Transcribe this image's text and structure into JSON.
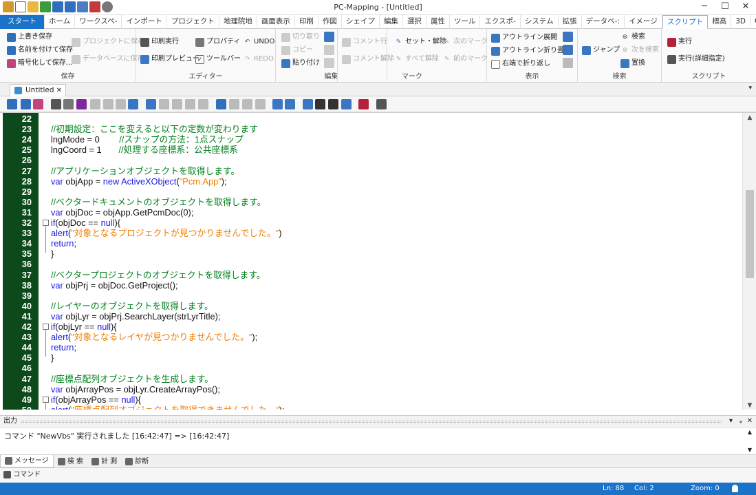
{
  "window": {
    "title": "PC-Mapping - [Untitled]",
    "minimize": "─",
    "maximize": "☐",
    "close": "✕"
  },
  "ribbon_tabs": [
    "スタート",
    "ホーム",
    "ワークスペ-",
    "インポート",
    "プロジェクト",
    "地理院地",
    "画面表示",
    "印刷",
    "作図",
    "シェイプ",
    "編集",
    "選択",
    "属性",
    "ツール",
    "エクスポ-",
    "システム",
    "拡張",
    "データベ-:",
    "イメージ",
    "スクリプト",
    "標高",
    "3D",
    "GL"
  ],
  "ribbon": {
    "save": {
      "label": "保存",
      "overwrite": "上書き保存",
      "save_as": "名前を付けて保存",
      "encrypt": "暗号化して保存...",
      "to_project": "プロジェクトに保存",
      "to_db": "データベースに保存"
    },
    "editor": {
      "label": "エディター",
      "print": "印刷実行",
      "preview": "印刷プレビュー",
      "property": "プロパティ",
      "toolbar": "ツールバー"
    },
    "edit": {
      "label": "編集",
      "undo": "UNDO",
      "redo": "REDO",
      "cut": "切り取り",
      "copy": "コピー",
      "paste": "貼り付け"
    },
    "mark": {
      "label": "マーク",
      "comment": "コメント行",
      "uncomment": "コメント解除",
      "set_clear": "セット・解除",
      "clear_all": "すべて解除",
      "next": "次のマーク",
      "prev": "前のマーク"
    },
    "view": {
      "label": "表示",
      "outline_expand": "アウトライン展開",
      "outline_fold": "アウトライン折り畳み",
      "wrap_right": "右端で折り返し"
    },
    "search": {
      "label": "検索",
      "jump": "ジャンプ",
      "find": "検索",
      "find_next": "次を検索",
      "replace": "置換"
    },
    "script": {
      "label": "スクリプト",
      "run": "実行",
      "run_detail": "実行(詳細指定)"
    }
  },
  "doc_tab": {
    "name": "Untitled",
    "close": "✕"
  },
  "code_lines": [
    {
      "n": "22",
      "segs": []
    },
    {
      "n": "23",
      "segs": [
        [
          "cmt",
          "//初期設定：ここを変えると以下の定数が変わります"
        ]
      ]
    },
    {
      "n": "24",
      "segs": [
        [
          "pl",
          "lngMode = 0        "
        ],
        [
          "cmt",
          "//スナップの方法：1点スナップ"
        ]
      ]
    },
    {
      "n": "25",
      "segs": [
        [
          "pl",
          "lngCoord = 1       "
        ],
        [
          "cmt",
          "//処理する座標系：公共座標系"
        ]
      ]
    },
    {
      "n": "26",
      "segs": []
    },
    {
      "n": "27",
      "segs": [
        [
          "cmt",
          "//アプリケーションオブジェクトを取得します。"
        ]
      ]
    },
    {
      "n": "28",
      "segs": [
        [
          "kw",
          "var "
        ],
        [
          "pl",
          "objApp = "
        ],
        [
          "kw",
          "new ActiveXObject"
        ],
        [
          "pl",
          "("
        ],
        [
          "str",
          "\"Pcm.App\""
        ],
        [
          "pl",
          ");"
        ]
      ]
    },
    {
      "n": "29",
      "segs": []
    },
    {
      "n": "30",
      "segs": [
        [
          "cmt",
          "//ベクタードキュメントのオブジェクトを取得します。"
        ]
      ]
    },
    {
      "n": "31",
      "segs": [
        [
          "kw",
          "var "
        ],
        [
          "pl",
          "objDoc = objApp.GetPcmDoc(0);"
        ]
      ]
    },
    {
      "n": "32",
      "fold": true,
      "segs": [
        [
          "kw",
          "if"
        ],
        [
          "pl",
          "(objDoc == "
        ],
        [
          "kw",
          "null"
        ],
        [
          "pl",
          "){"
        ]
      ]
    },
    {
      "n": "33",
      "segs": [
        [
          "kw",
          "alert"
        ],
        [
          "pl",
          "("
        ],
        [
          "str",
          "\"対象となるプロジェクトが見つかりませんでした。\""
        ],
        [
          "pl",
          ")"
        ]
      ]
    },
    {
      "n": "34",
      "segs": [
        [
          "kw",
          "return"
        ],
        [
          "pl",
          ";"
        ]
      ]
    },
    {
      "n": "35",
      "segs": [
        [
          "pl",
          "}"
        ]
      ]
    },
    {
      "n": "36",
      "segs": []
    },
    {
      "n": "37",
      "segs": [
        [
          "cmt",
          "//ベクタープロジェクトのオブジェクトを取得します。"
        ]
      ]
    },
    {
      "n": "38",
      "segs": [
        [
          "kw",
          "var "
        ],
        [
          "pl",
          "objPrj = objDoc.GetProject();"
        ]
      ]
    },
    {
      "n": "39",
      "segs": []
    },
    {
      "n": "40",
      "segs": [
        [
          "cmt",
          "//レイヤーのオブジェクトを取得します。"
        ]
      ]
    },
    {
      "n": "41",
      "segs": [
        [
          "kw",
          "var "
        ],
        [
          "pl",
          "objLyr = objPrj.SearchLayer(strLyrTitle);"
        ]
      ]
    },
    {
      "n": "42",
      "fold": true,
      "segs": [
        [
          "kw",
          "if"
        ],
        [
          "pl",
          "(objLyr == "
        ],
        [
          "kw",
          "null"
        ],
        [
          "pl",
          "){"
        ]
      ]
    },
    {
      "n": "43",
      "segs": [
        [
          "kw",
          "alert"
        ],
        [
          "pl",
          "("
        ],
        [
          "str",
          "\"対象となるレイヤが見つかりませんでした。\""
        ],
        [
          "pl",
          ");"
        ]
      ]
    },
    {
      "n": "44",
      "segs": [
        [
          "kw",
          "return"
        ],
        [
          "pl",
          ";"
        ]
      ]
    },
    {
      "n": "45",
      "segs": [
        [
          "pl",
          "}"
        ]
      ]
    },
    {
      "n": "46",
      "segs": []
    },
    {
      "n": "47",
      "segs": [
        [
          "cmt",
          "//座標点配列オブジェクトを生成します。"
        ]
      ]
    },
    {
      "n": "48",
      "segs": [
        [
          "kw",
          "var "
        ],
        [
          "pl",
          "objArrayPos = objLyr.CreateArrayPos();"
        ]
      ]
    },
    {
      "n": "49",
      "fold": true,
      "segs": [
        [
          "kw",
          "if"
        ],
        [
          "pl",
          "(objArrayPos == "
        ],
        [
          "kw",
          "null"
        ],
        [
          "pl",
          "){"
        ]
      ]
    },
    {
      "n": "50",
      "segs": [
        [
          "kw",
          "alert"
        ],
        [
          "pl",
          "("
        ],
        [
          "str",
          "\"座標点配列オブジェクトを取得できませんでした。\""
        ],
        [
          "pl",
          ");"
        ]
      ]
    }
  ],
  "output": {
    "title": "出力",
    "pin": "ᵩ",
    "close": "✕",
    "message": "コマンド   \"NewVbs\" 実行されました [16:42:47] => [16:42:47]"
  },
  "output_tabs": [
    "メッセージ",
    "検 索",
    "計 測",
    "診断"
  ],
  "command_label": "コマンド",
  "status": {
    "ln": "Ln:  88",
    "col": "Col:  2",
    "zoom": "Zoom:  0"
  },
  "colors": {
    "accent": "#1a73c9",
    "gutter": "#0d4a1b",
    "comment": "#00801c",
    "keyword": "#1a1adf",
    "string": "#f07d00"
  }
}
